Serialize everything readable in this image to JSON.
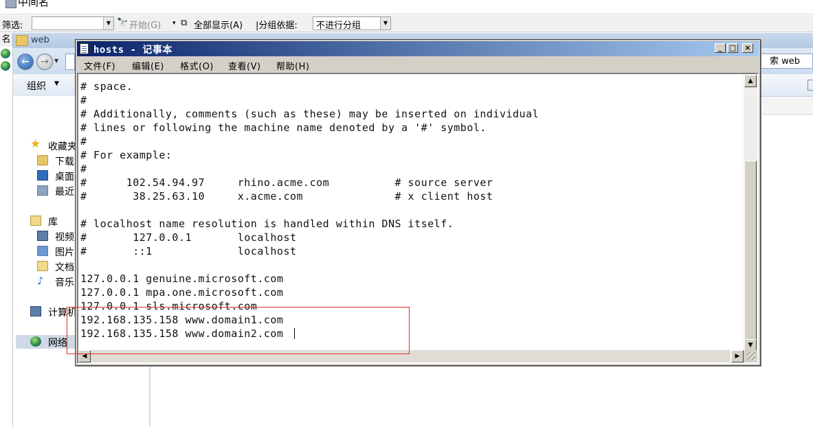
{
  "iis": {
    "title": "中间名",
    "filter": {
      "label": "筛选:",
      "start_label": "开始(G)",
      "show_all_label": "全部显示(A)",
      "group_label": "|分组依据:",
      "group_value": "不进行分组"
    },
    "name_header": "名"
  },
  "explorer": {
    "title": "web",
    "search_text": "索 web",
    "organize_label": "组织",
    "nav": [
      {
        "label": "收藏夹",
        "icon": "star-icon"
      },
      {
        "label": "下载",
        "icon": "folder-icon"
      },
      {
        "label": "桌面",
        "icon": "desktop-icon"
      },
      {
        "label": "最近",
        "icon": "recent-icon"
      },
      {
        "label": "库",
        "icon": "library-icon"
      },
      {
        "label": "视频",
        "icon": "video-icon"
      },
      {
        "label": "图片",
        "icon": "picture-icon"
      },
      {
        "label": "文档",
        "icon": "document-icon"
      },
      {
        "label": "音乐",
        "icon": "music-icon"
      },
      {
        "label": "计算机",
        "icon": "computer-icon"
      },
      {
        "label": "网络",
        "icon": "network-icon"
      }
    ]
  },
  "notepad": {
    "title": "hosts - 记事本",
    "controls": {
      "minimize": "_",
      "maximize": "□",
      "close": "×"
    },
    "menu": [
      "文件(F)",
      "编辑(E)",
      "格式(O)",
      "查看(V)",
      "帮助(H)"
    ],
    "lines": [
      "# space.",
      "#",
      "# Additionally, comments (such as these) may be inserted on individual",
      "# lines or following the machine name denoted by a '#' symbol.",
      "#",
      "# For example:",
      "#",
      "#      102.54.94.97     rhino.acme.com          # source server",
      "#       38.25.63.10     x.acme.com              # x client host",
      "",
      "# localhost name resolution is handled within DNS itself.",
      "#       127.0.0.1       localhost",
      "#       ::1             localhost",
      "",
      "127.0.0.1 genuine.microsoft.com",
      "127.0.0.1 mpa.one.microsoft.com",
      "127.0.0.1 sls.microsoft.com",
      "192.168.135.158 www.domain1.com",
      "192.168.135.158 www.domain2.com"
    ]
  },
  "colors": {
    "highlight_box": "#e0301f",
    "title_bar_start": "#0a246a",
    "title_bar_end": "#a6caf0"
  }
}
